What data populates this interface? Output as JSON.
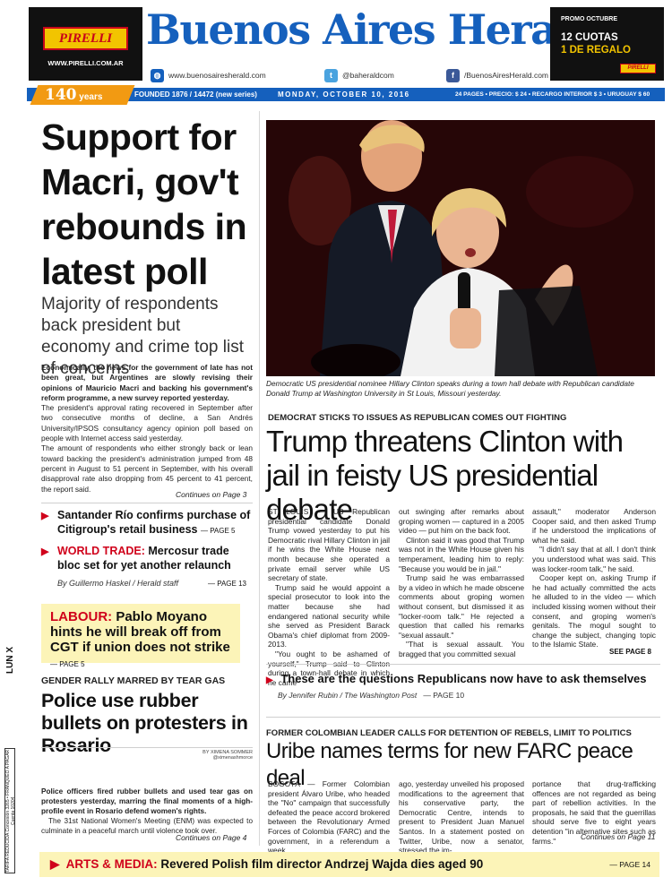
{
  "masthead": {
    "title": "Buenos Aires Herald",
    "website": "www.buenosairesherald.com",
    "twitter": "@baheraldcom",
    "facebook": "/BuenosAiresHerald.com"
  },
  "ad_left": {
    "brand": "PIRELLI",
    "url": "WWW.PIRELLI.COM.AR"
  },
  "ad_right": {
    "small": "PROMO OCTUBRE",
    "line1": "12 CUOTAS",
    "line2": "1 DE REGALO",
    "brand": "PIRELLI"
  },
  "infobar": {
    "years_num": "140",
    "years_word": "years",
    "founded": "FOUNDED 1876 / 14472 (new series)",
    "date": "MONDAY, OCTOBER 10, 2016",
    "price": "24 PAGES • PRECIO: $ 24 • RECARGO INTERIOR $ 3 • URUGUAY $ 60"
  },
  "lead": {
    "headline": "Support for Macri, gov't rebounds in latest poll",
    "subhead": "Majority of respondents back president but economy and crime top list of concerns",
    "body": [
      "Economically, the news for the government of late has not been great, but Argentines are slowly revising their opinions of Mauricio Macri and backing his government's reform programme, a new survey reported yesterday.",
      "The president's approval rating recovered in September after two consecutive months of decline, a San Andrés University/IPSOS consultancy agency opinion poll based on people with Internet access said yesterday.",
      "The amount of respondents who either strongly back or lean toward backing the president's administration jumped from 48 percent in August to 51 percent in September, with his overall disapproval rate also dropping from 45 percent to 41 percent, the report said."
    ],
    "continues": "Continues on Page 3"
  },
  "teasers": {
    "santander": {
      "text": "Santander Río confirms purchase of Citigroup's retail business",
      "page": "— PAGE 5"
    },
    "world_trade": {
      "label": "WORLD TRADE:",
      "text": "Mercosur trade bloc set for yet another relaunch",
      "byline": "By Guillermo Haskel / Herald staff",
      "page": "— PAGE 13"
    },
    "labour": {
      "label": "LABOUR:",
      "text": "Pablo Moyano hints he will break off from CGT if union does not strike",
      "page": "— PAGE 5"
    }
  },
  "rosario": {
    "kicker": "GENDER RALLY MARRED BY TEAR GAS",
    "headline": "Police use rubber bullets on protesters in Rosario",
    "credit1": "BY XIMENA SOMMER",
    "credit2": "@ximenashmorce",
    "body": [
      "Police officers fired rubber bullets and used tear gas on protesters yesterday, marring the final moments of a high-profile event in Rosario defend women's rights.",
      "The 31st National Women's Meeting (ENM) was expected to culminate in a peaceful march until violence took over."
    ],
    "continues": "Continues on Page 4"
  },
  "photo": {
    "caption": "Democratic US presidential nominee Hillary Clinton speaks during a town hall debate with Republican candidate Donald Trump at Washington University in St Louis, Missouri yesterday."
  },
  "trump": {
    "kicker": "DEMOCRAT STICKS TO ISSUES AS REPUBLICAN COMES OUT FIGHTING",
    "headline": "Trump threatens Clinton with jail in feisty US presidential debate",
    "col1": [
      "ST LOUIS — US Republican presidential candidate Donald Trump vowed yesterday to put his Democratic rival Hillary Clinton in jail if he wins the White House next month because she operated a private email server while US secretary of state.",
      "Trump said he would appoint a special prosecutor to look into the matter because she had endangered national security while she served as President Barack Obama's chief diplomat from 2009-2013.",
      "\"You ought to be ashamed of yourself,\" Trump said to Clinton during a town-hall debate in which he came"
    ],
    "col2": [
      "out swinging after remarks about groping women — captured in a 2005 video — put him on the back foot.",
      "Clinton said it was good that Trump was not in the White House given his temperament, leading him to reply: \"Because you would be in jail.\"",
      "Trump said he was embarrassed by a video in which he made obscene comments about groping women without consent, but dismissed it as \"locker-room talk.\" He rejected a question that called his remarks \"sexual assault.\"",
      "\"That is sexual assault. You bragged that you committed sexual"
    ],
    "col3": [
      "assault,\" moderator Anderson Cooper said, and then asked Trump if he understood the implications of what he said.",
      "\"I didn't say that at all. I don't think you understood what was said. This was locker-room talk,\" he said.",
      "Cooper kept on, asking Trump if he had actually committed the acts he alluded to in the video — which included kissing women without their consent, and groping women's genitals. The mogul sought to change the subject, changing topic to the Islamic State."
    ],
    "see_page": "SEE PAGE 8"
  },
  "republicans": {
    "text": "These are the questions Republicans now have to ask themselves",
    "byline": "By Jennifer Rubin / The Washington Post",
    "page": "— PAGE 10"
  },
  "uribe": {
    "kicker": "FORMER COLOMBIAN LEADER CALLS FOR DETENTION OF REBELS, LIMIT TO POLITICS",
    "headline": "Uribe names terms for new FARC peace deal",
    "col1": "BOGOTÁ — Former Colombian president Álvaro Uribe, who headed the \"No\" campaign that successfully defeated the peace accord brokered between the Revolutionary Armed Forces of Colombia (FARC) and the government, in a referendum a week",
    "col2": "ago, yesterday unveiled his proposed modifications to the agreement that his conservative party, the Democratic Centre, intends to present to President Juan Manuel Santos. In a statement posted on Twitter, Uribe, now a senator, stressed the im-",
    "col3": "portance that drug-trafficking offences are not regarded as being part of rebellion activities. In the proposals, he said that the guerrillas should serve five to eight years detention \"in alternative sites such as farms.\"",
    "continues": "Continues on Page 11"
  },
  "arts": {
    "label": "ARTS & MEDIA:",
    "text": "Revered Polish film director Andrzej Wajda dies aged 90",
    "page": "— PAGE 14"
  },
  "side": {
    "day": "LUN X",
    "box": "TARIFA REDUCIDA Concesión 3265 • FRANQUEO A PAGAR Cuenta 10204"
  },
  "colors": {
    "brand_blue": "#1560bd",
    "accent_red": "#d0021b",
    "badge_orange": "#f29a12",
    "highlight_yellow": "#fcf4b8"
  }
}
